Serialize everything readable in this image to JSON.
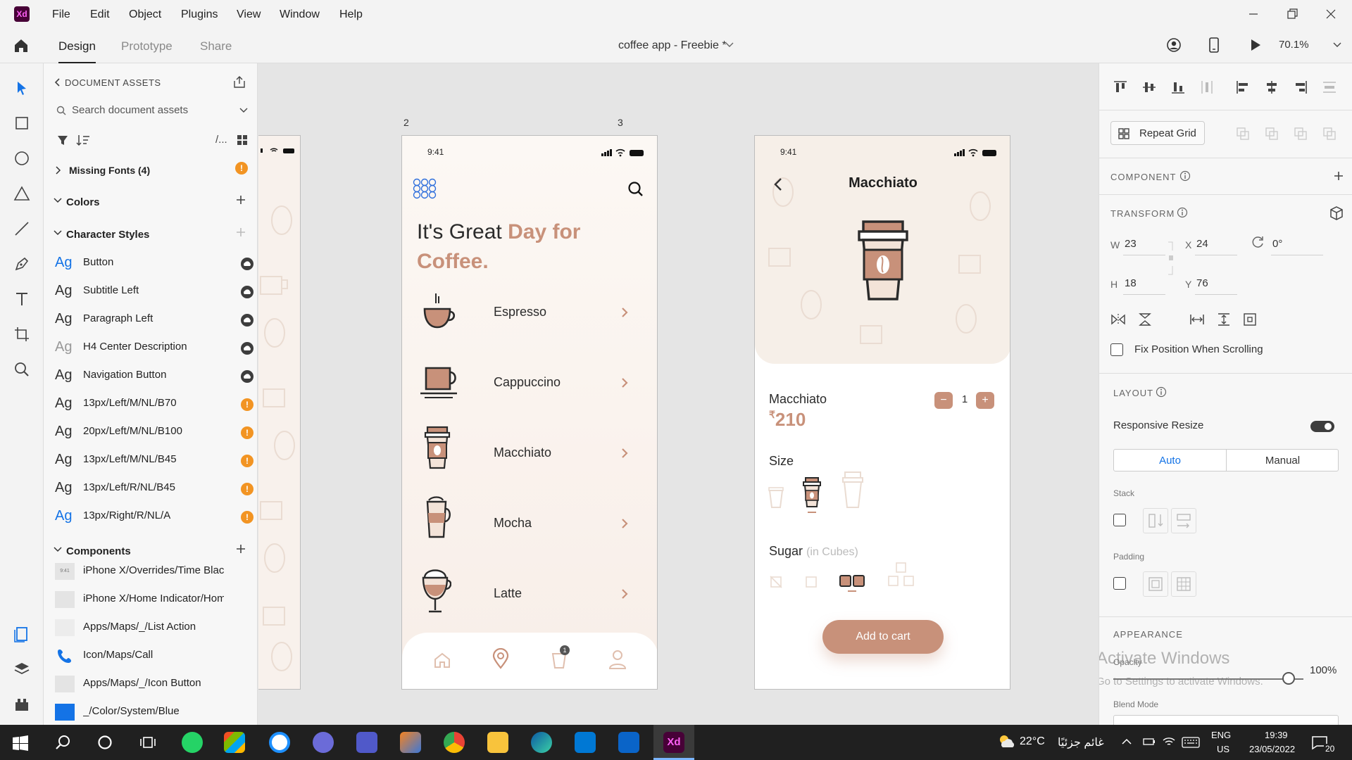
{
  "app": {
    "logo": "Xd",
    "menu": [
      "File",
      "Edit",
      "Object",
      "Plugins",
      "View",
      "Window",
      "Help"
    ],
    "tabs": [
      "Design",
      "Prototype",
      "Share"
    ],
    "document_title": "coffee app - Freebie *",
    "zoom": "70.1%"
  },
  "assets": {
    "header": "DOCUMENT ASSETS",
    "search_placeholder": "Search document assets",
    "view_toggle": "/...",
    "missing_fonts": "Missing Fonts (4)",
    "colors_title": "Colors",
    "char_styles_title": "Character Styles",
    "ag": "Ag",
    "char_styles": [
      {
        "label": "Button",
        "status": "cloud"
      },
      {
        "label": "Subtitle Left",
        "status": "cloud"
      },
      {
        "label": "Paragraph Left",
        "status": "cloud"
      },
      {
        "label": "H4 Center Description",
        "status": "cloud"
      },
      {
        "label": "Navigation Button",
        "status": "cloud"
      },
      {
        "label": "13px/Left/M/NL/B70",
        "status": "warning"
      },
      {
        "label": "20px/Left/M/NL/B100",
        "status": "warning"
      },
      {
        "label": "13px/Left/M/NL/B45",
        "status": "warning"
      },
      {
        "label": "13px/Left/R/NL/B45",
        "status": "warning"
      },
      {
        "label": "13px/Right/R/NL/A",
        "status": "warning"
      }
    ],
    "components_title": "Components",
    "components": [
      "iPhone X/Overrides/Time Black",
      "iPhone X/Home Indicator/Home...",
      "Apps/Maps/_/List Action",
      "Icon/Maps/Call",
      "Apps/Maps/_/Icon Button",
      "_/Color/System/Blue"
    ],
    "thumb_time": "9:41"
  },
  "artboard2": {
    "label": "2",
    "time": "9:41",
    "headline_a": "It's Great ",
    "headline_b": "Day for",
    "headline_c": "Coffee.",
    "items": [
      "Espresso",
      "Cappuccino",
      "Macchiato",
      "Mocha",
      "Latte"
    ],
    "cart_badge": "1",
    "accent": "#c8917a"
  },
  "artboard3": {
    "label": "3",
    "time": "9:41",
    "title": "Macchiato",
    "product_name": "Macchiato",
    "qty": "1",
    "currency": "₹",
    "price": "210",
    "size_label": "Size",
    "sugar_label": "Sugar",
    "sugar_unit": "(in Cubes)",
    "cta": "Add to cart",
    "minus": "−",
    "plus": "+"
  },
  "props": {
    "repeat_grid": "Repeat Grid",
    "component": "COMPONENT",
    "transform": "TRANSFORM",
    "w_lbl": "W",
    "w": "23",
    "x_lbl": "X",
    "x": "24",
    "h_lbl": "H",
    "h": "18",
    "y_lbl": "Y",
    "y": "76",
    "rotation": "0°",
    "fix_position": "Fix Position When Scrolling",
    "layout": "LAYOUT",
    "responsive": "Responsive Resize",
    "auto": "Auto",
    "manual": "Manual",
    "stack": "Stack",
    "padding": "Padding",
    "appearance": "APPEARANCE",
    "opacity_lbl": "Opacity",
    "opacity": "100%",
    "blend": "Blend Mode",
    "watermark1": "Activate Windows",
    "watermark2": "Go to Settings to activate Windows."
  },
  "taskbar": {
    "weather": "22°C",
    "weather_text": "غائم جزئيًا",
    "lang1": "ENG",
    "lang2": "US",
    "time": "19:39",
    "date": "23/05/2022",
    "notif": "20"
  }
}
